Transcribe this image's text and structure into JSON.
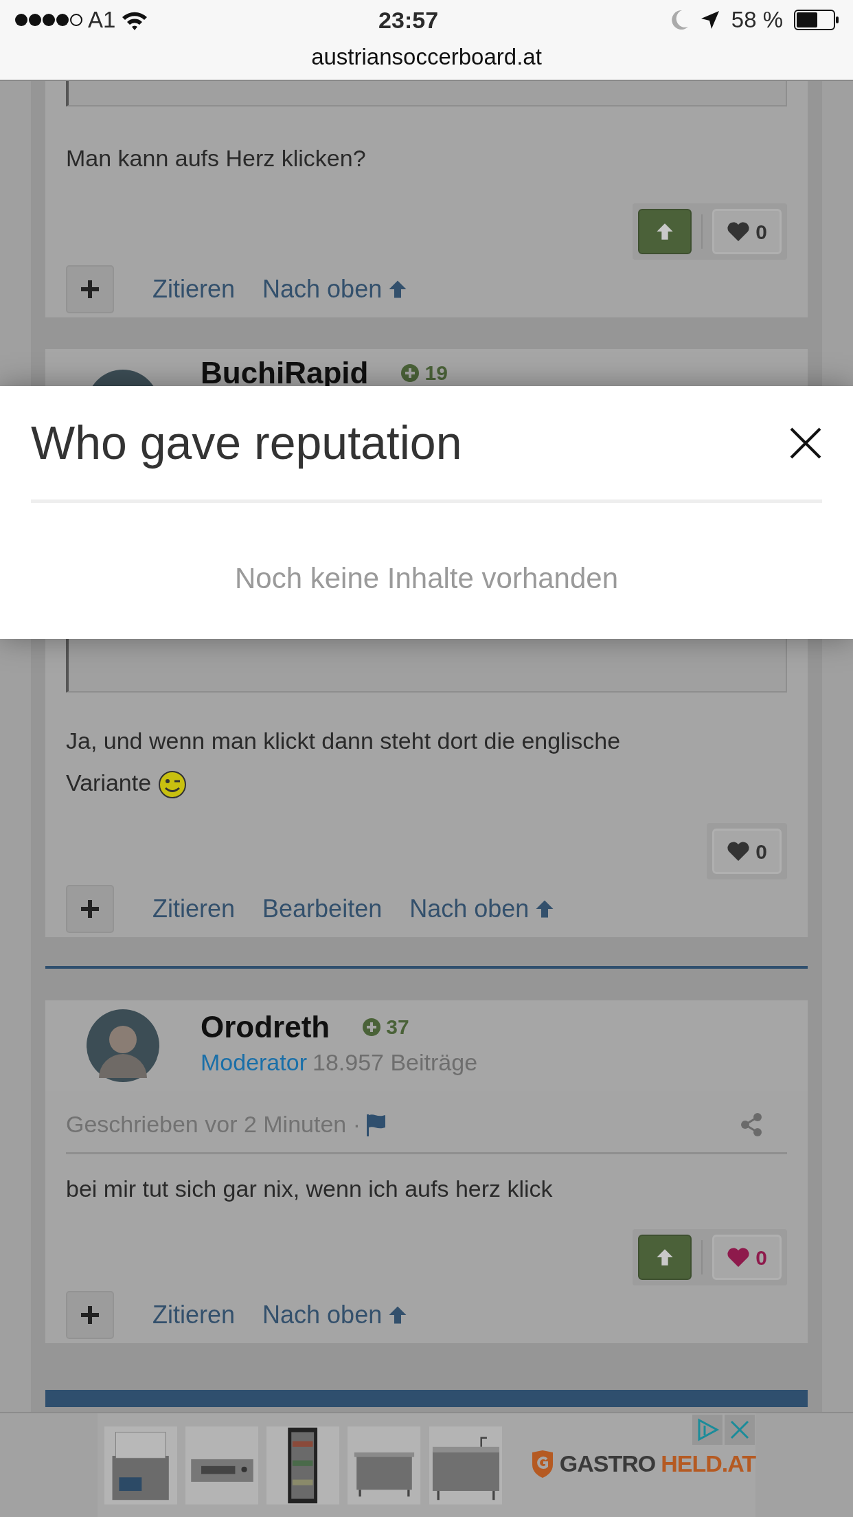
{
  "status_bar": {
    "carrier": "A1",
    "time": "23:57",
    "battery": "58 %",
    "url": "austriansoccerboard.at"
  },
  "posts": [
    {
      "has_quote": true,
      "text": "Man kann aufs Herz klicken?",
      "emoji": false,
      "upvote": true,
      "like_count": "0",
      "liked": false,
      "actions": [
        "Zitieren",
        "Nach oben"
      ]
    },
    {
      "author": "BuchiRapid",
      "reputation": "19",
      "has_quote": true,
      "text": "Ja, und wenn man klickt dann steht dort die englische Variante",
      "emoji": true,
      "upvote": false,
      "like_count": "0",
      "liked": false,
      "actions": [
        "Zitieren",
        "Bearbeiten",
        "Nach oben"
      ]
    },
    {
      "author": "Orodreth",
      "reputation": "37",
      "role": "Moderator",
      "post_count": "18.957 Beiträge",
      "meta": "Geschrieben vor 2 Minuten ·",
      "has_quote": false,
      "text": "bei mir tut sich gar nix, wenn ich aufs herz klick",
      "emoji": false,
      "upvote": true,
      "like_count": "0",
      "liked": true,
      "actions": [
        "Zitieren",
        "Nach oben"
      ]
    }
  ],
  "modal": {
    "title": "Who gave reputation",
    "empty_text": "Noch keine Inhalte vorhanden"
  },
  "ad": {
    "logo_text": "GASTRO",
    "logo_accent": "HELD.AT"
  }
}
